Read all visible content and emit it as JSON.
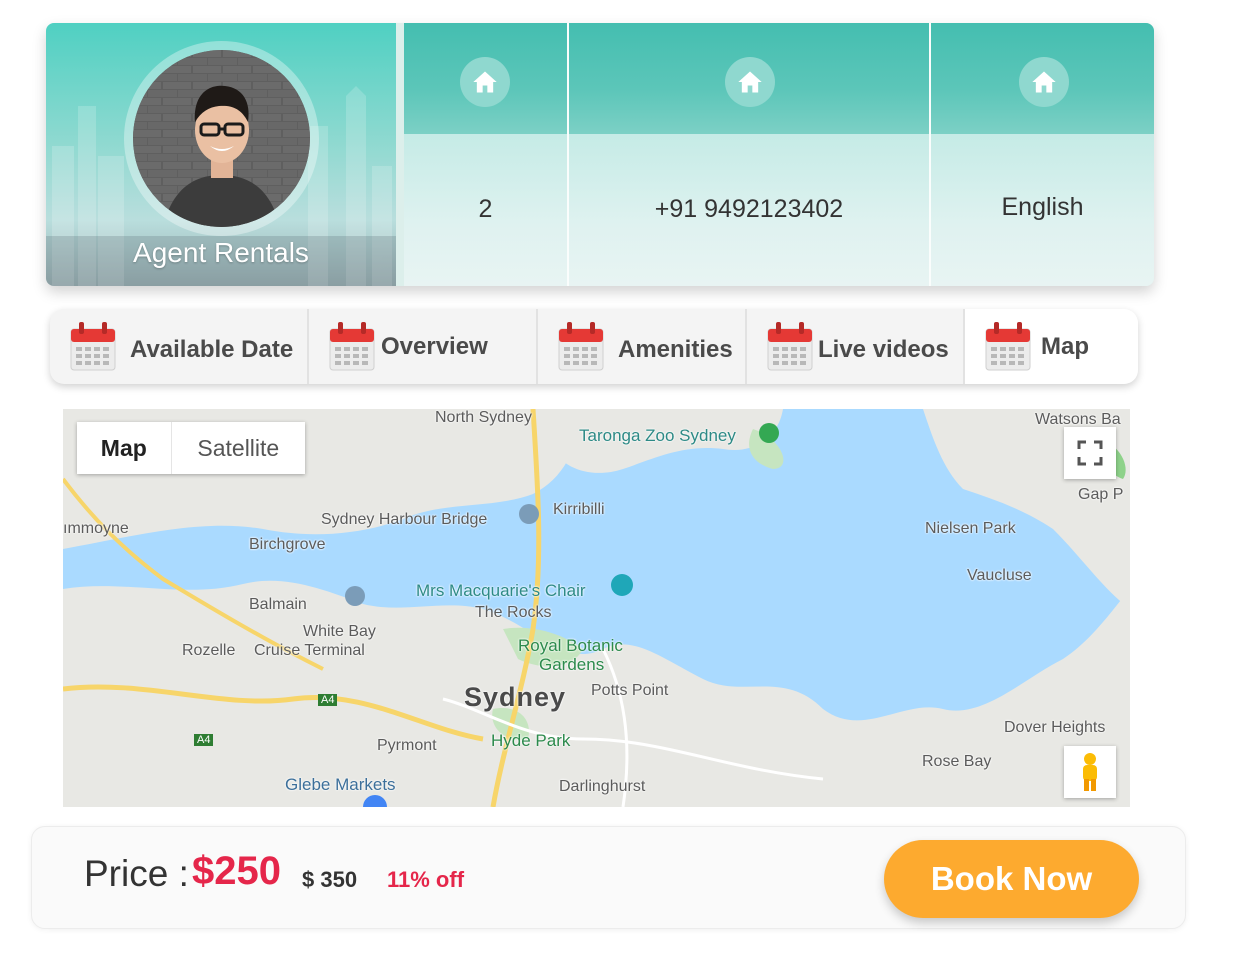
{
  "agent": {
    "name": "Agent Rentals"
  },
  "info": [
    {
      "icon": "home-icon",
      "value": "2"
    },
    {
      "icon": "home-icon",
      "value": "+91 9492123402"
    },
    {
      "icon": "home-icon",
      "value": "English"
    }
  ],
  "tabs": [
    {
      "icon": "calendar-icon",
      "label": "Available Date",
      "active": false
    },
    {
      "icon": "calendar-icon",
      "label": "Overview",
      "active": false
    },
    {
      "icon": "calendar-icon",
      "label": "Amenities",
      "active": false
    },
    {
      "icon": "calendar-icon",
      "label": "Live videos",
      "active": false
    },
    {
      "icon": "calendar-icon",
      "label": "Map",
      "active": true
    }
  ],
  "map": {
    "type_toggle": {
      "map_label": "Map",
      "satellite_label": "Satellite",
      "selected": "Map"
    },
    "labels": {
      "north_sydney": "North Sydney",
      "taronga": "Taronga Zoo Sydney",
      "watsons_bay": "Watsons Ba",
      "gap_park": "Gap P",
      "drummoyne": "ımmoyne",
      "harbour_bridge": "Sydney Harbour Bridge",
      "kirribilli": "Kirribilli",
      "birchgrove": "Birchgrove",
      "nielsen_park": "Nielsen Park",
      "vaucluse": "Vaucluse",
      "balmain": "Balmain",
      "mrs_macquarie": "Mrs Macquarie's Chair",
      "the_rocks": "The Rocks",
      "white_bay": "White Bay",
      "cruise_terminal": "Cruise Terminal",
      "rozelle": "Rozelle",
      "botanic_1": "Royal Botanic",
      "botanic_2": "Gardens",
      "potts_point": "Potts Point",
      "sydney": "Sydney",
      "dover_heights": "Dover Heights",
      "a4_1": "A4",
      "a4_2": "A4",
      "pyrmont": "Pyrmont",
      "hyde_park": "Hyde Park",
      "rose_bay": "Rose Bay",
      "glebe_markets": "Glebe Markets",
      "darlinghurst": "Darlinghurst"
    }
  },
  "price": {
    "label": "Price :",
    "current": "$250",
    "original": "$ 350",
    "discount": "11%  off"
  },
  "book_button": "Book Now",
  "colors": {
    "teal": "#44beb0",
    "price_red": "#e5264a",
    "book_orange": "#fdaa2f",
    "calendar_red": "#e53935"
  }
}
